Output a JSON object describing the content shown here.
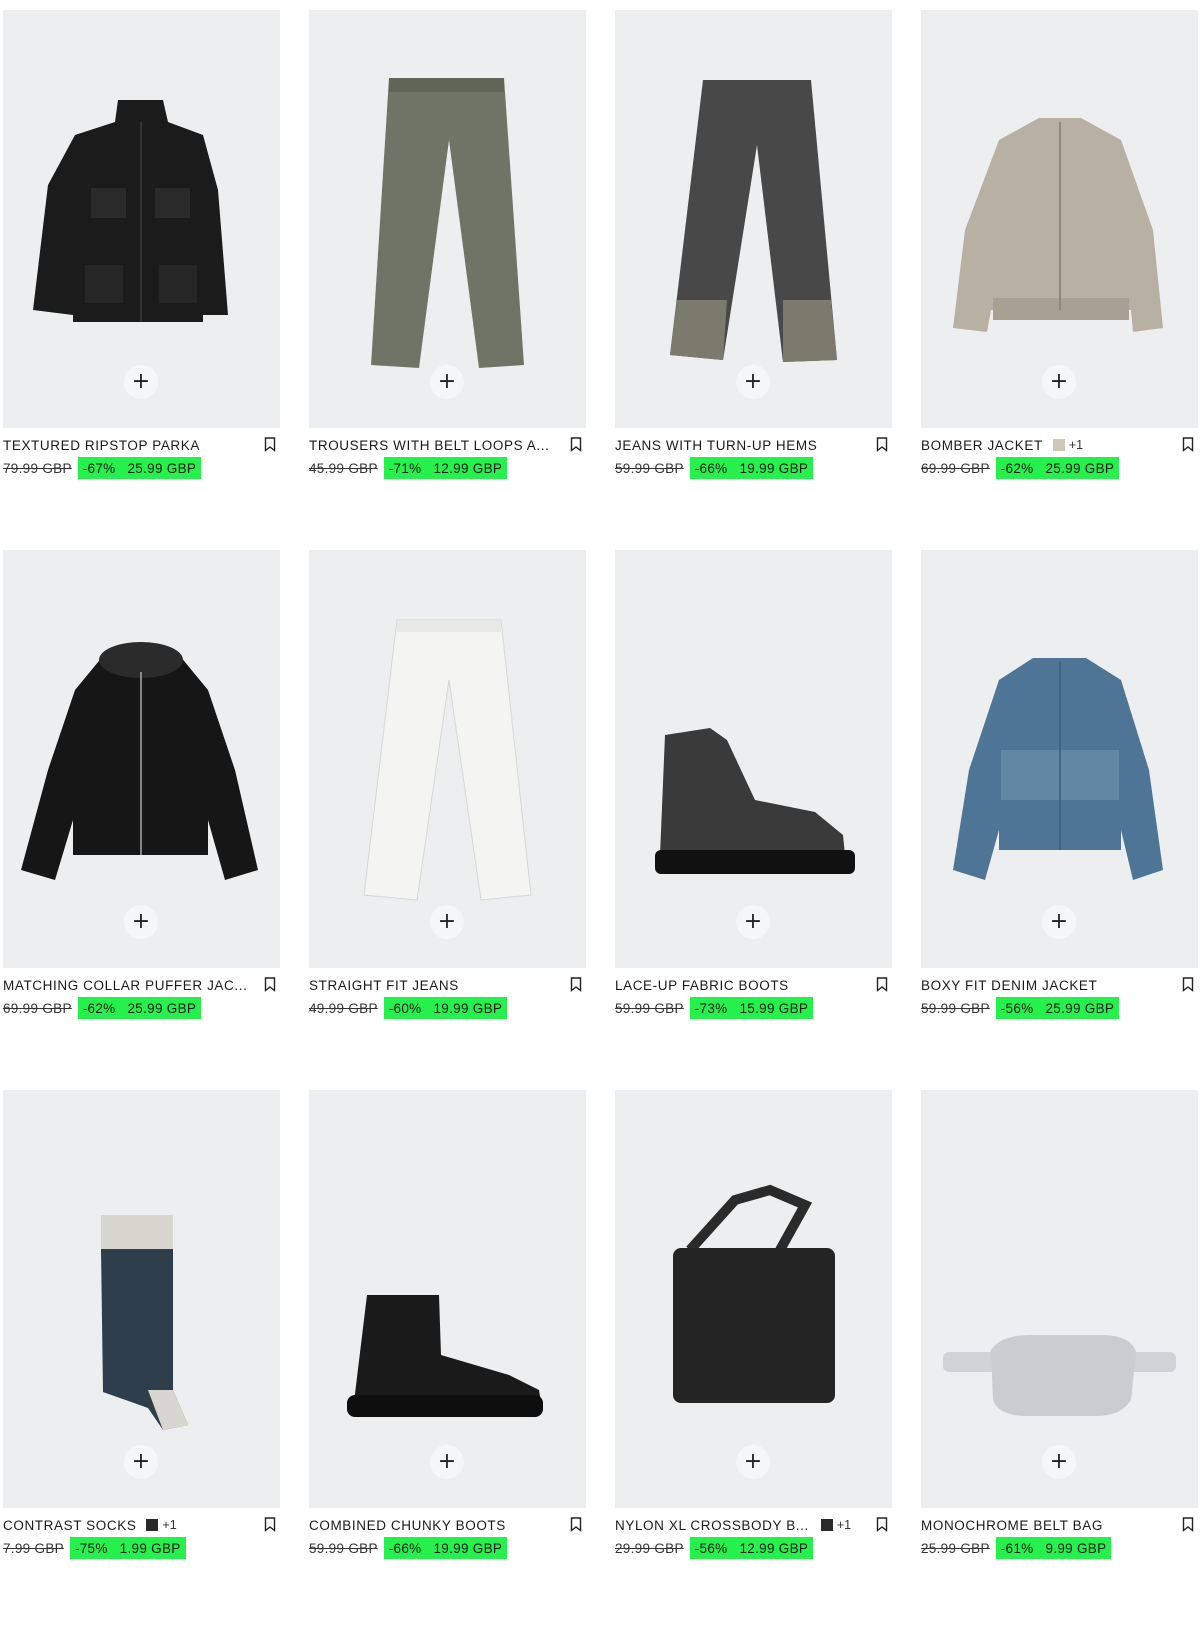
{
  "add_label": "+",
  "products": [
    {
      "name": "TEXTURED RIPSTOP PARKA",
      "old_price": "79.99 GBP",
      "discount": "-67%",
      "new_price": "25.99 GBP"
    },
    {
      "name": "TROUSERS WITH BELT LOOPS A...",
      "old_price": "45.99 GBP",
      "discount": "-71%",
      "new_price": "12.99 GBP"
    },
    {
      "name": "JEANS WITH TURN-UP HEMS",
      "old_price": "59.99 GBP",
      "discount": "-66%",
      "new_price": "19.99 GBP"
    },
    {
      "name": "BOMBER JACKET",
      "old_price": "69.99 GBP",
      "discount": "-62%",
      "new_price": "25.99 GBP",
      "swatch_color": "#cfc6b8",
      "more_colors": "+1"
    },
    {
      "name": "MATCHING COLLAR PUFFER JAC...",
      "old_price": "69.99 GBP",
      "discount": "-62%",
      "new_price": "25.99 GBP"
    },
    {
      "name": "STRAIGHT FIT JEANS",
      "old_price": "49.99 GBP",
      "discount": "-60%",
      "new_price": "19.99 GBP"
    },
    {
      "name": "LACE-UP FABRIC BOOTS",
      "old_price": "59.99 GBP",
      "discount": "-73%",
      "new_price": "15.99 GBP"
    },
    {
      "name": "BOXY FIT DENIM JACKET",
      "old_price": "59.99 GBP",
      "discount": "-56%",
      "new_price": "25.99 GBP"
    },
    {
      "name": "CONTRAST SOCKS",
      "old_price": "7.99 GBP",
      "discount": "-75%",
      "new_price": "1.99 GBP",
      "swatch_color": "#2a2a2a",
      "more_colors": "+1"
    },
    {
      "name": "COMBINED CHUNKY BOOTS",
      "old_price": "59.99 GBP",
      "discount": "-66%",
      "new_price": "19.99 GBP"
    },
    {
      "name": "NYLON XL CROSSBODY B...",
      "old_price": "29.99 GBP",
      "discount": "-56%",
      "new_price": "12.99 GBP",
      "swatch_color": "#2a2a2a",
      "more_colors": "+1"
    },
    {
      "name": "MONOCHROME BELT BAG",
      "old_price": "25.99 GBP",
      "discount": "-61%",
      "new_price": "9.99 GBP"
    }
  ],
  "colors": {
    "sale_badge": "#26f04c",
    "image_bg": "#eceef0"
  }
}
